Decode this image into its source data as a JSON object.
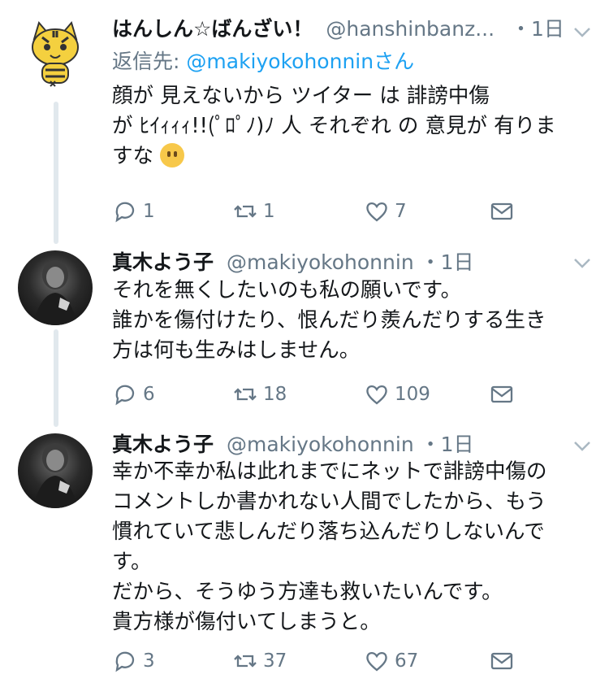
{
  "tweets": [
    {
      "name": "はんしん☆ばんざい！",
      "handle": "@hanshinbanz...",
      "time": "・1日",
      "reply_prefix": "返信先:",
      "reply_handle": "@makiyokohonninさん",
      "text": "顔が 見えないから ツイター は 誹謗中傷\nが ﾋｲｨｨｨ!!(ﾟﾛﾟﾉ)ﾉ 人 それぞれ の 意見が 有りま\nすな",
      "emoji": "neutral-face-emoji",
      "replies": "1",
      "retweets": "1",
      "likes": "7"
    },
    {
      "name": "真木よう子",
      "handle": "@makiyokohonnin",
      "time": "・1日",
      "text": "それを無くしたいのも私の願いです。\n誰かを傷付けたり、恨んだり羨んだりする生き\n方は何も生みはしません。",
      "replies": "6",
      "retweets": "18",
      "likes": "109"
    },
    {
      "name": "真木よう子",
      "handle": "@makiyokohonnin",
      "time": "・1日",
      "text": "幸か不幸か私は此れまでにネットで誹謗中傷の\nコメントしか書かれない人間でしたから、もう\n慣れていて悲しんだり落ち込んだりしないんで\nす。\nだから、そうゆう方達も救いたいんです。\n貴方様が傷付いてしまうと。",
      "replies": "3",
      "retweets": "37",
      "likes": "67"
    }
  ],
  "colors": {
    "text": "#14171a",
    "muted": "#657786",
    "link": "#1da1f2",
    "thread": "#e1e8ed"
  }
}
